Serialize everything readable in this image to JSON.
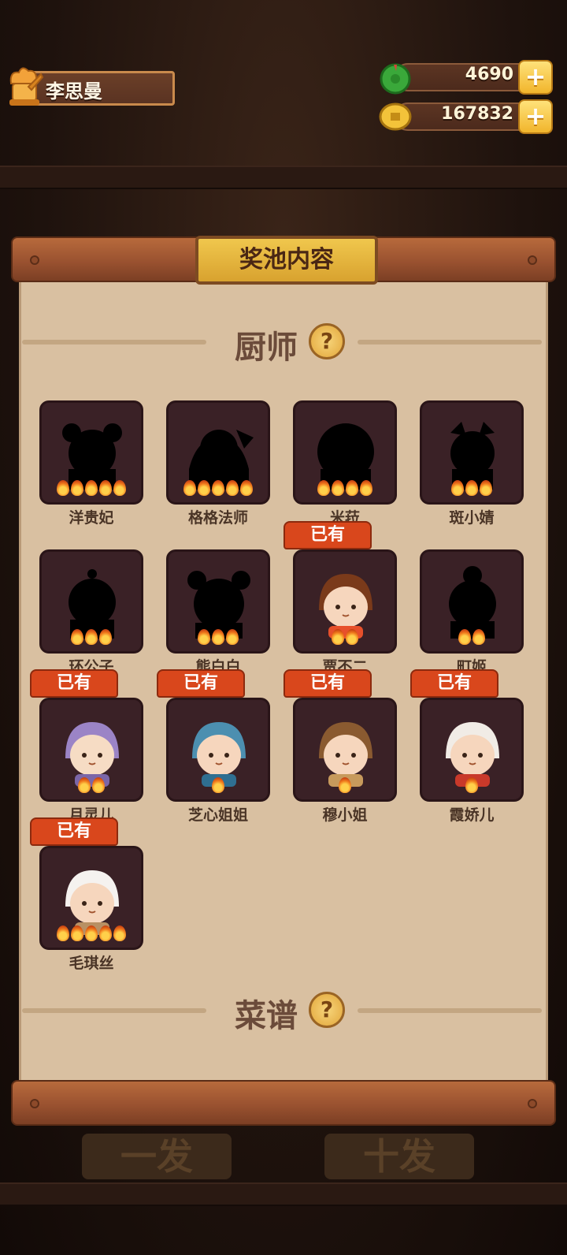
{
  "player": {
    "name": "李思曼"
  },
  "resources": [
    {
      "icon": "jade-icon",
      "value": "4690",
      "plus": "+"
    },
    {
      "icon": "coin-icon",
      "value": "167832",
      "plus": "+"
    }
  ],
  "panel": {
    "title": "奖池内容"
  },
  "sections": {
    "chef": {
      "title": "厨师",
      "help": "?"
    },
    "recipe": {
      "title": "菜谱",
      "help": "?"
    }
  },
  "owned_label": "已有",
  "chefs": [
    {
      "name": "洋贵妃",
      "stars": 5,
      "owned": false
    },
    {
      "name": "格格法师",
      "stars": 5,
      "owned": false
    },
    {
      "name": "米菈",
      "stars": 4,
      "owned": false
    },
    {
      "name": "斑小婧",
      "stars": 3,
      "owned": false
    },
    {
      "name": "环公子",
      "stars": 3,
      "owned": false
    },
    {
      "name": "熊白白",
      "stars": 3,
      "owned": false
    },
    {
      "name": "贾不二",
      "stars": 2,
      "owned": true
    },
    {
      "name": "町姬",
      "stars": 2,
      "owned": false
    },
    {
      "name": "月灵儿",
      "stars": 2,
      "owned": true
    },
    {
      "name": "芝心姐姐",
      "stars": 1,
      "owned": true
    },
    {
      "name": "穆小姐",
      "stars": 1,
      "owned": true
    },
    {
      "name": "霞娇儿",
      "stars": 1,
      "owned": true
    },
    {
      "name": "毛琪丝",
      "stars": 5,
      "owned": true
    }
  ],
  "bottom_buttons": [
    "一发",
    "十发"
  ],
  "colors": {
    "badge": "#d9471c",
    "paper": "#d9c0a1",
    "card": "#3a2126"
  }
}
